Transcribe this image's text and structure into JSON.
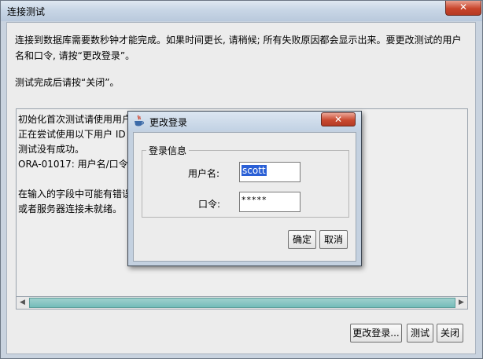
{
  "outer_window": {
    "title": "连接测试",
    "close_glyph": "✕",
    "intro_line": "连接到数据库需要数秒钟才能完成。如果时间更长, 请稍候; 所有失败原因都会显示出来。要更改测试的用户名和口令, 请按“更改登录”。",
    "intro_line2": "测试完成后请按“关闭”。",
    "log_lines": [
      "初始化首次测试请使用用户",
      "正在尝试使用以下用户 ID",
      "测试没有成功。",
      "ORA-01017: 用户名/口令无",
      "",
      "在输入的字段中可能有错误",
      "或者服务器连接未就绪。"
    ],
    "buttons": {
      "change_login": "更改登录...",
      "test": "测试",
      "close": "关闭"
    }
  },
  "dialog": {
    "title": "更改登录",
    "close_glyph": "✕",
    "group_title": "登录信息",
    "username_label": "用户名:",
    "username_value": "scott",
    "password_label": "口令:",
    "password_masked": "*****",
    "buttons": {
      "ok": "确定",
      "cancel": "取消"
    }
  },
  "icons": {
    "dialog_icon": "java-icon",
    "scroll_left": "left-arrow-icon",
    "scroll_right": "right-arrow-icon"
  },
  "colors": {
    "selection": "#2b60d6",
    "scroll_thumb": "#74bcb9",
    "close_button": "#c8452c"
  }
}
